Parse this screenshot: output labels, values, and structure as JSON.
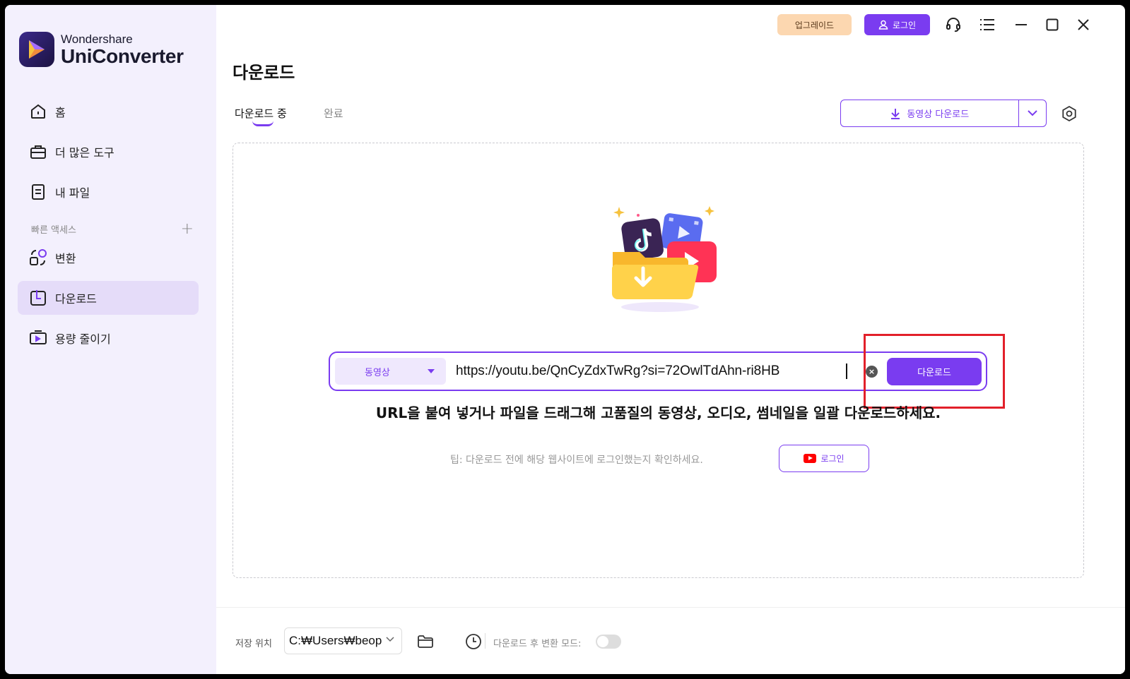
{
  "app": {
    "brand_sub": "Wondershare",
    "brand_main": "UniConverter"
  },
  "sidebar": {
    "items": [
      {
        "label": "홈",
        "icon": "home-icon"
      },
      {
        "label": "더 많은 도구",
        "icon": "toolbox-icon"
      },
      {
        "label": "내 파일",
        "icon": "file-icon"
      }
    ],
    "quick_access_label": "빠른 액세스",
    "quick_items": [
      {
        "label": "변환",
        "icon": "convert-icon"
      },
      {
        "label": "다운로드",
        "icon": "download-nav-icon",
        "active": true
      },
      {
        "label": "용량 줄이기",
        "icon": "compress-icon"
      }
    ]
  },
  "header": {
    "upgrade_label": "업그레이드",
    "login_label": "로그인"
  },
  "page": {
    "title": "다운로드",
    "tabs": [
      {
        "label": "다운로드 중",
        "active": true
      },
      {
        "label": "완료",
        "active": false
      }
    ],
    "video_download_label": "동영상 다운로드"
  },
  "dropzone": {
    "type_selected": "동영상",
    "url_value": "https://youtu.be/QnCyZdxTwRg?si=72OwlTdAhn-ri8HB",
    "download_label": "다운로드",
    "instruction": "URL을 붙여 넣거나 파일을 드래그해 고품질의 동영상, 오디오, 썸네일을 일괄 다운로드하세요.",
    "tip": "팁: 다운로드 전에 해당 웹사이트에 로그인했는지 확인하세요.",
    "yt_login_label": "로그인"
  },
  "footer": {
    "save_location_label": "저장 위치",
    "path_value": "C:₩Users₩beop",
    "convert_mode_label": "다운로드 후 변환 모드:",
    "convert_mode_on": false
  },
  "colors": {
    "accent": "#7a3cf0",
    "sidebar_bg": "#f3f0fd",
    "active_nav_bg": "#e5dcf9",
    "upgrade_bg": "#fcd7b0",
    "highlight": "#e2202a"
  }
}
